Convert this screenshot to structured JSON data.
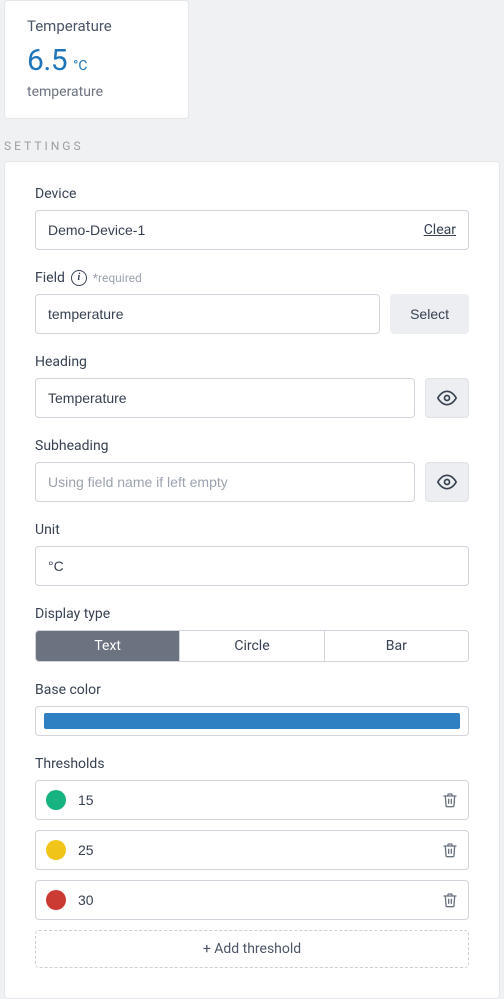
{
  "preview": {
    "heading": "Temperature",
    "value": "6.5",
    "unit": "°C",
    "subheading": "temperature"
  },
  "section_title": "SETTINGS",
  "device": {
    "label": "Device",
    "value": "Demo-Device-1",
    "clear": "Clear"
  },
  "field": {
    "label": "Field",
    "hint": "*required",
    "value": "temperature",
    "select_btn": "Select"
  },
  "heading": {
    "label": "Heading",
    "value": "Temperature"
  },
  "subheading": {
    "label": "Subheading",
    "value": "",
    "placeholder": "Using field name if left empty"
  },
  "unit": {
    "label": "Unit",
    "value": "°C"
  },
  "display_type": {
    "label": "Display type",
    "options": [
      "Text",
      "Circle",
      "Bar"
    ],
    "active": "Text"
  },
  "base_color": {
    "label": "Base color",
    "value": "#2f80c2"
  },
  "thresholds": {
    "label": "Thresholds",
    "items": [
      {
        "color": "#16b27f",
        "value": "15"
      },
      {
        "color": "#f0c419",
        "value": "25"
      },
      {
        "color": "#cc3b33",
        "value": "30"
      }
    ],
    "add_label": "+ Add threshold"
  },
  "icons": {
    "eye": "eye-icon",
    "trash": "trash-icon",
    "info": "info-icon"
  }
}
